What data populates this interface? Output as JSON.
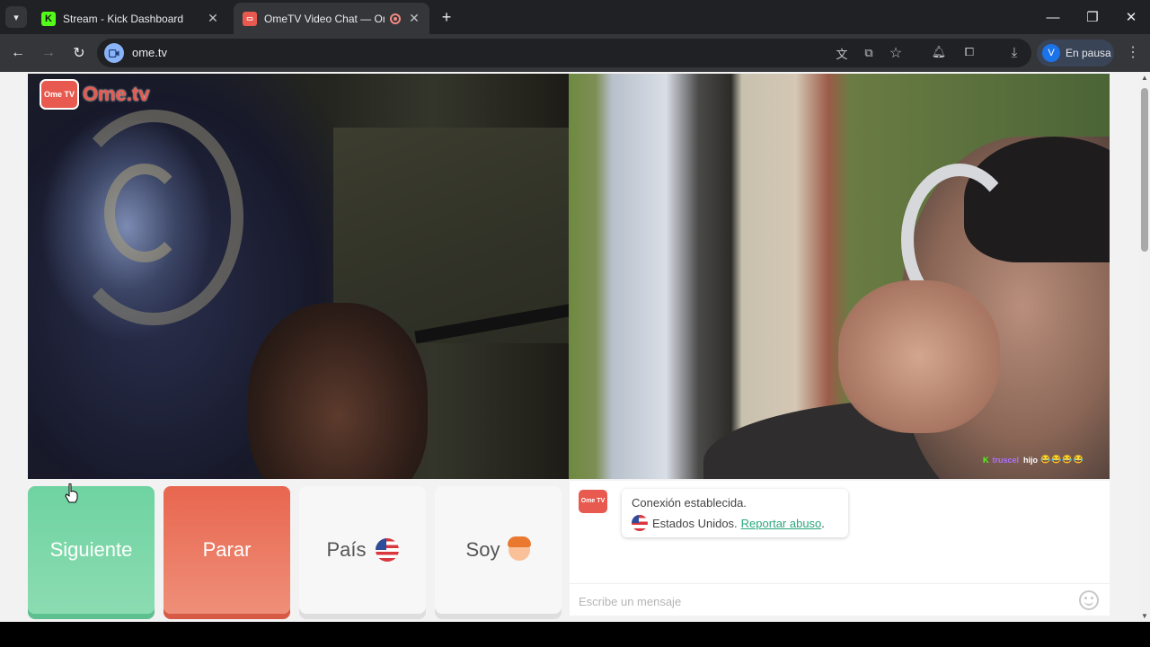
{
  "browser": {
    "tabs": [
      {
        "title": "Stream - Kick Dashboard",
        "favicon": "kick-logo-icon",
        "active": false
      },
      {
        "title": "OmeTV Video Chat — Ome",
        "favicon": "ometv-favicon-icon",
        "active": true,
        "recording": true
      }
    ],
    "url": "ome.tv",
    "profile": {
      "initial": "V",
      "label": "En pausa"
    }
  },
  "page": {
    "logo_badge": "Ome TV",
    "logo_text": "Ome.tv",
    "remote_overlay": {
      "platform_icon": "K",
      "user": "truscel",
      "message": "hijo",
      "emojis": "😂😂😂😂"
    },
    "buttons": {
      "next": "Siguiente",
      "stop": "Parar",
      "country": "País",
      "gender": "Soy"
    },
    "chat": {
      "badge": "Ome TV",
      "status": "Conexión establecida.",
      "country": "Estados Unidos.",
      "report": "Reportar abuso",
      "report_suffix": ".",
      "placeholder": "Escribe un mensaje"
    }
  },
  "colors": {
    "next_button": "#6fd3a1",
    "stop_button": "#e8664f",
    "report_link": "#2aa87c",
    "brand": "#e85a4f"
  }
}
